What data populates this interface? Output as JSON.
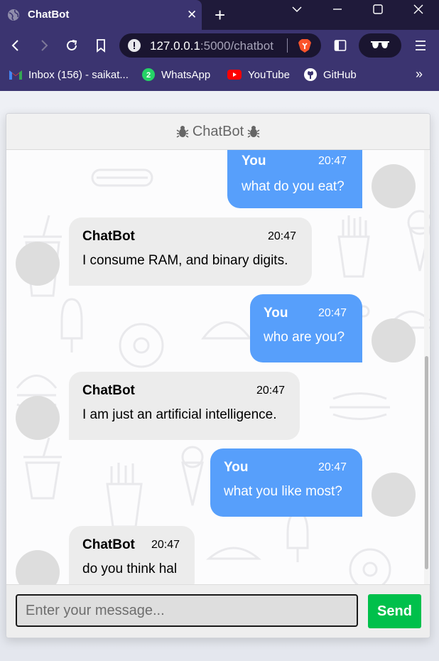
{
  "browser": {
    "tab_title": "ChatBot",
    "url_host": "127.0.0.1",
    "url_path": ":5000/chatbot",
    "bookmarks": [
      {
        "label": "Inbox (156) - saikat...",
        "icon": "gmail-icon"
      },
      {
        "label": "WhatsApp",
        "icon": "whatsapp-icon",
        "badge": "2"
      },
      {
        "label": "YouTube",
        "icon": "youtube-icon"
      },
      {
        "label": "GitHub",
        "icon": "github-icon"
      }
    ],
    "more_label": "»"
  },
  "chat": {
    "header_title": "ChatBot",
    "messages": [
      {
        "sender": "You",
        "time": "20:47",
        "text": "what do you eat?",
        "side": "user"
      },
      {
        "sender": "ChatBot",
        "time": "20:47",
        "text": "I consume RAM, and binary digits.",
        "side": "bot"
      },
      {
        "sender": "You",
        "time": "20:47",
        "text": "who are you?",
        "side": "user"
      },
      {
        "sender": "ChatBot",
        "time": "20:47",
        "text": "I am just an artificial intelligence.",
        "side": "bot"
      },
      {
        "sender": "You",
        "time": "20:47",
        "text": "what you like most?",
        "side": "user"
      },
      {
        "sender": "ChatBot",
        "time": "20:47",
        "text": "do you think hal",
        "side": "bot"
      }
    ],
    "input_placeholder": "Enter your message...",
    "send_label": "Send"
  },
  "colors": {
    "user_bubble": "#579ffb",
    "bot_bubble": "#ececec",
    "send_button": "#00c04b",
    "browser_chrome": "#3b3470"
  }
}
